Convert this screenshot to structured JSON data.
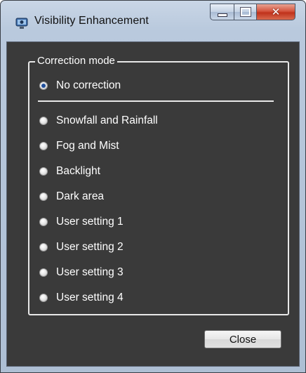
{
  "window": {
    "title": "Visibility Enhancement",
    "app_icon": "camera-monitor-icon",
    "caption_buttons": [
      "minimize-icon",
      "maximize-icon",
      "close-icon"
    ]
  },
  "group": {
    "label": "Correction mode"
  },
  "options": [
    {
      "label": "No correction",
      "checked": true
    },
    {
      "label": "Snowfall and Rainfall",
      "checked": false
    },
    {
      "label": "Fog and Mist",
      "checked": false
    },
    {
      "label": "Backlight",
      "checked": false
    },
    {
      "label": "Dark area",
      "checked": false
    },
    {
      "label": "User setting 1",
      "checked": false
    },
    {
      "label": "User setting 2",
      "checked": false
    },
    {
      "label": "User setting 3",
      "checked": false
    },
    {
      "label": "User setting 4",
      "checked": false
    }
  ],
  "buttons": {
    "close_label": "Close"
  },
  "colors": {
    "client_background": "#3a3a3a",
    "text": "#ffffff",
    "close_caption": "#c0321b"
  }
}
